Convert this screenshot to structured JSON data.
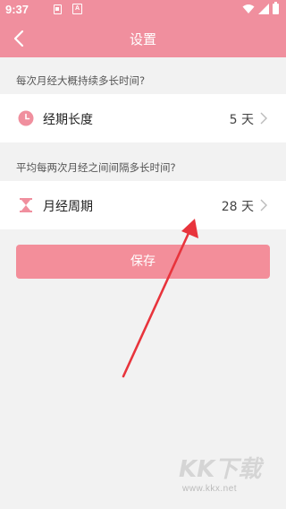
{
  "status_bar": {
    "time": "9:37",
    "icons": [
      "notification-icon",
      "a-icon",
      "wifi-icon",
      "signal-icon",
      "battery-icon"
    ]
  },
  "app_bar": {
    "title": "设置",
    "back_icon": "chevron-left-icon"
  },
  "sections": [
    {
      "question": "每次月经大概持续多长时间?",
      "item": {
        "icon": "clock-icon",
        "label": "经期长度",
        "value": "5 天"
      }
    },
    {
      "question": "平均每两次月经之间间隔多长时间?",
      "item": {
        "icon": "hourglass-icon",
        "label": "月经周期",
        "value": "28 天"
      }
    }
  ],
  "save_label": "保存",
  "watermark": {
    "logo_text": "KK下载",
    "url": "www.kkx.net"
  },
  "colors": {
    "accent": "#f08f9e",
    "button": "#f38e9a",
    "background": "#f2f2f2",
    "arrow": "#e8343c"
  }
}
